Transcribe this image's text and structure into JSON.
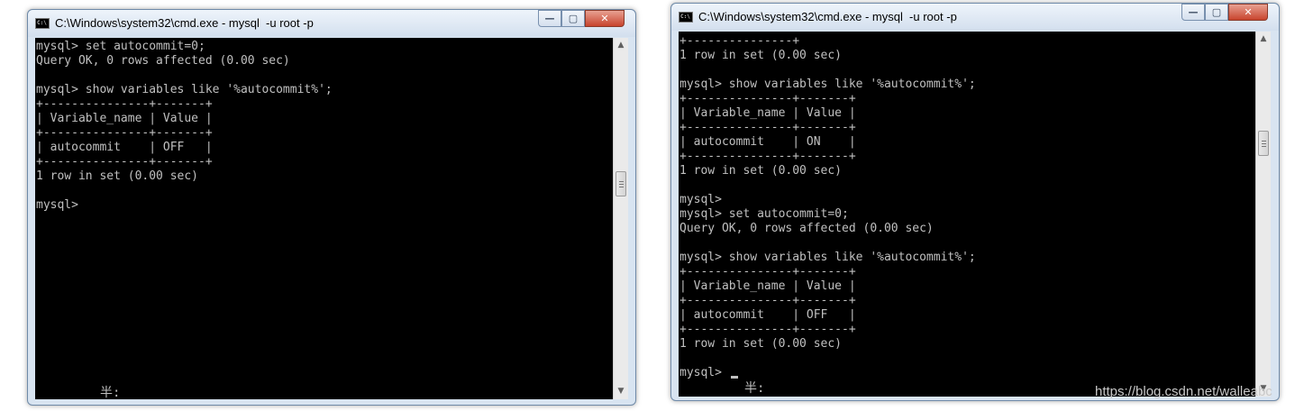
{
  "windows": [
    {
      "title": "C:\\Windows\\system32\\cmd.exe - mysql  -u root -p",
      "icon_text": "C:\\",
      "controls": {
        "minimize": "—",
        "maximize": "▢",
        "close": "✕"
      },
      "console_lines": "mysql> set autocommit=0;\nQuery OK, 0 rows affected (0.00 sec)\n\nmysql> show variables like '%autocommit%';\n+---------------+-------+\n| Variable_name | Value |\n+---------------+-------+\n| autocommit    | OFF   |\n+---------------+-------+\n1 row in set (0.00 sec)\n\nmysql>",
      "ime_indicator": "半:",
      "scroll_up": "▲",
      "scroll_down": "▼"
    },
    {
      "title": "C:\\Windows\\system32\\cmd.exe - mysql  -u root -p",
      "icon_text": "C:\\",
      "controls": {
        "minimize": "—",
        "maximize": "▢",
        "close": "✕"
      },
      "console_lines": "+---------------+\n1 row in set (0.00 sec)\n\nmysql> show variables like '%autocommit%';\n+---------------+-------+\n| Variable_name | Value |\n+---------------+-------+\n| autocommit    | ON    |\n+---------------+-------+\n1 row in set (0.00 sec)\n\nmysql>\nmysql> set autocommit=0;\nQuery OK, 0 rows affected (0.00 sec)\n\nmysql> show variables like '%autocommit%';\n+---------------+-------+\n| Variable_name | Value |\n+---------------+-------+\n| autocommit    | OFF   |\n+---------------+-------+\n1 row in set (0.00 sec)\n\nmysql>",
      "ime_indicator": "半:",
      "scroll_up": "▲",
      "scroll_down": "▼"
    }
  ],
  "watermark": "https://blog.csdn.net/walleabc"
}
